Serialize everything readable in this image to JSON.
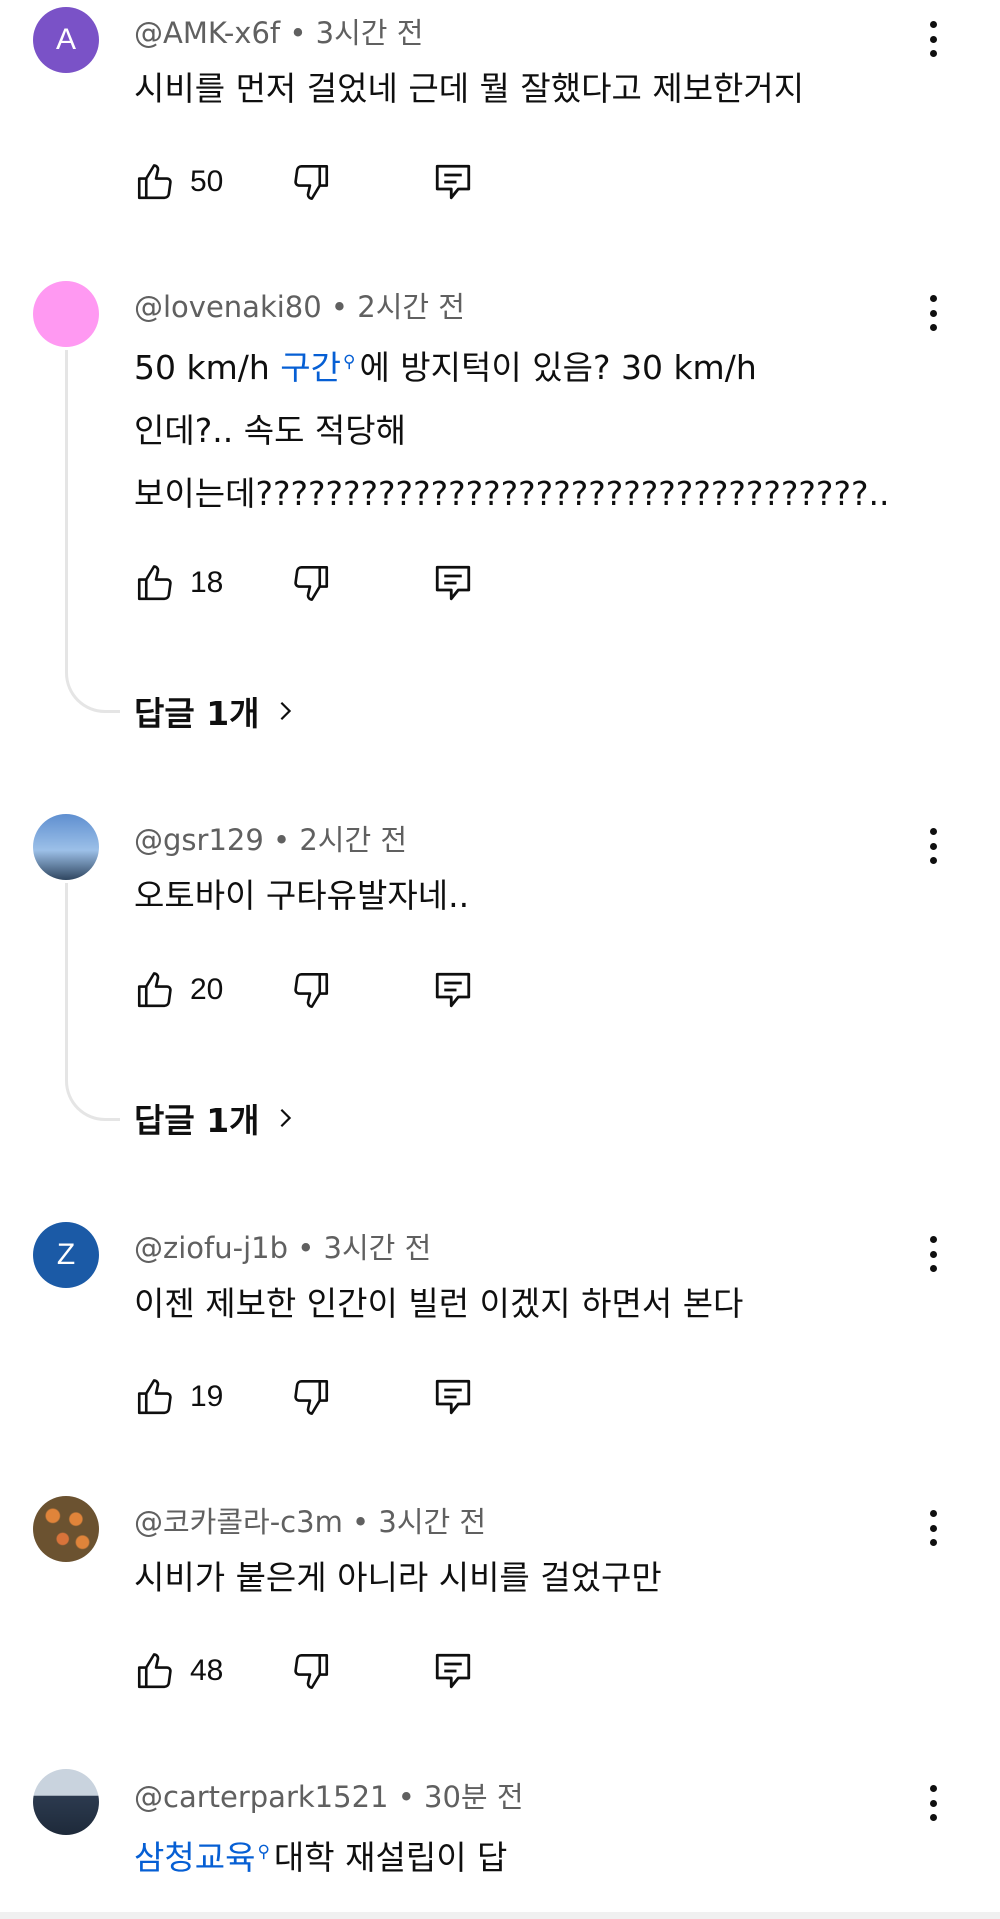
{
  "comments": [
    {
      "avatar_letter": "A",
      "avatar_color": "#7a52c7",
      "handle": "@AMK-x6f",
      "time": "3시간 전",
      "text": "시비를 먼저 걸었네 근데 뭘 잘했다고 제보한거지",
      "likes": "50"
    },
    {
      "avatar_letter": "",
      "avatar_color": "#ff99f2",
      "handle": "@lovenaki80",
      "time": "2시간 전",
      "text_line1_pre": "50 km/h ",
      "text_link": "구간",
      "text_line1_post": "에 방지턱이 있음? 30 km/h",
      "text_line2": "인데?.. 속도 적당해",
      "text_line3": "보이는데???????????????????????????????????..",
      "likes": "18",
      "replies": "답글 1개"
    },
    {
      "avatar_letter": "",
      "avatar_color": "#6f93c4",
      "handle": "@gsr129",
      "time": "2시간 전",
      "text": "오토바이 구타유발자네..",
      "likes": "20",
      "replies": "답글 1개"
    },
    {
      "avatar_letter": "Z",
      "avatar_color": "#1b5aa6",
      "handle": "@ziofu-j1b",
      "time": "3시간 전",
      "text": "이젠 제보한 인간이 빌런 이겠지 하면서 본다",
      "likes": "19"
    },
    {
      "avatar_letter": "",
      "avatar_color": "#7a5a2e",
      "handle": "@코카콜라-c3m",
      "time": "3시간 전",
      "text": "시비가 붙은게 아니라 시비를 걸었구만",
      "likes": "48"
    },
    {
      "avatar_letter": "",
      "avatar_color": "#3b4d66",
      "handle": "@carterpark1521",
      "time": "30분 전",
      "text_link": "삼청교육",
      "text_post": "대학 재설립이 답"
    }
  ],
  "separator": " • ",
  "icons": {
    "like": "thumbs-up-icon",
    "dislike": "thumbs-down-icon",
    "reply": "reply-comment-icon",
    "more": "more-vertical-icon",
    "search": "search-magnifier-icon",
    "chevron": "chevron-right-icon"
  }
}
